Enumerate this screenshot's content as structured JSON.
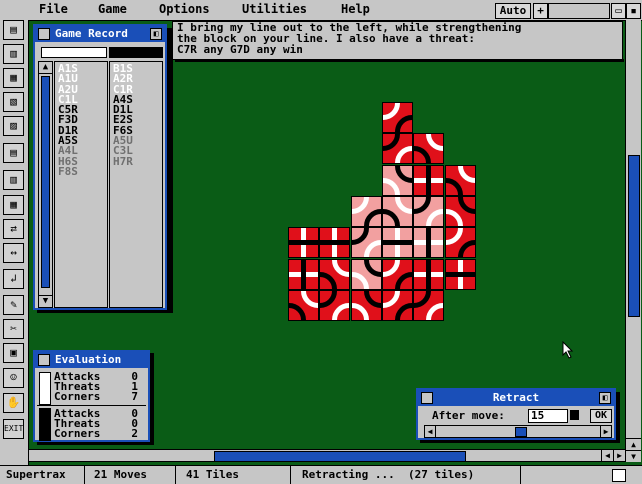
{
  "menubar": {
    "items": [
      "File",
      "Game",
      "Options",
      "Utilities",
      "Help"
    ],
    "auto_label": "Auto",
    "plus_label": "+"
  },
  "message": {
    "line1": "I bring my line out to the left, while strengthening",
    "line2": "the block on your line. I also have a threat:",
    "line3": "C7R any G7D any win"
  },
  "game_record": {
    "title": "Game Record",
    "white_moves": [
      "A1S",
      "A1U",
      "A2U",
      "C1L",
      "C5R",
      "F3D",
      "D1R",
      "A5S",
      "A4L",
      "H6S",
      "F8S"
    ],
    "black_moves": [
      "B1S",
      "A2R",
      "C1R",
      "A4S",
      "D1L",
      "E2S",
      "F6S",
      "A5U",
      "C3L",
      "H7R"
    ],
    "white_highlight_count": 4,
    "black_highlight_count": 3,
    "white_dim_from": 8,
    "black_dim_from": 7
  },
  "evaluation": {
    "title": "Evaluation",
    "white": [
      {
        "label": "Attacks",
        "value": "0"
      },
      {
        "label": "Threats",
        "value": "1"
      },
      {
        "label": "Corners",
        "value": "7"
      }
    ],
    "black": [
      {
        "label": "Attacks",
        "value": "0"
      },
      {
        "label": "Threats",
        "value": "0"
      },
      {
        "label": "Corners",
        "value": "2"
      }
    ]
  },
  "retract": {
    "title": "Retract",
    "after_move_label": "After move:",
    "after_move_value": "15",
    "ok_label": "OK",
    "slider_fraction": 0.52
  },
  "status": {
    "app": "Supertrax",
    "moves": "21 Moves",
    "tiles": "41 Tiles",
    "message": "Retracting ...  (27 tiles)"
  },
  "colors": {
    "board": "#0a5c16",
    "window_border": "#1a4fb8",
    "tile_red": "#e0101a",
    "tile_pink": "#f2a0a0"
  }
}
